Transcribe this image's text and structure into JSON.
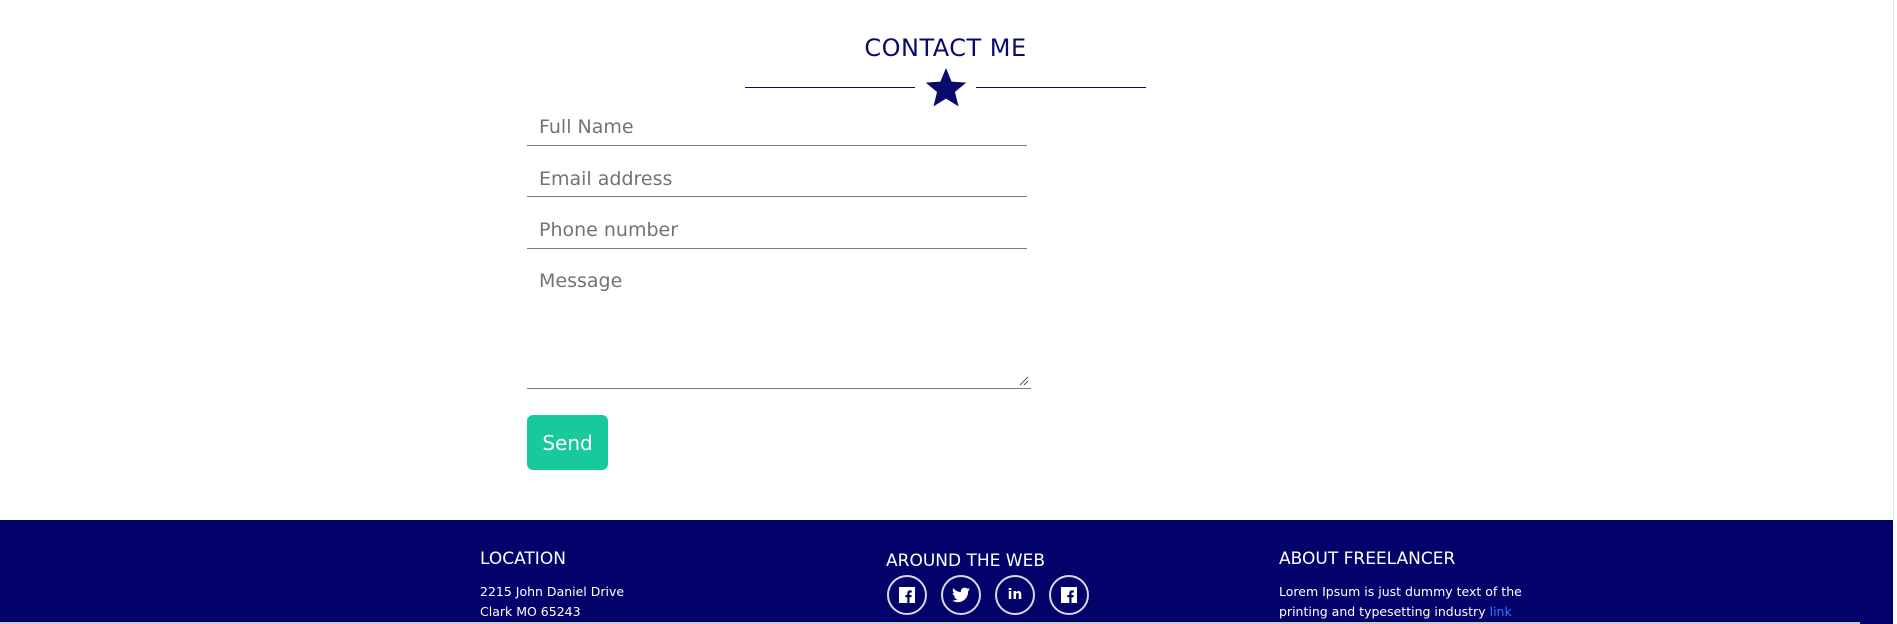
{
  "contact": {
    "title": "CONTACT ME",
    "divider_icon": "star-icon",
    "fields": {
      "full_name_placeholder": "Full Name",
      "email_placeholder": "Email address",
      "phone_placeholder": "Phone number",
      "message_placeholder": "Message"
    },
    "send_label": "Send"
  },
  "footer": {
    "location": {
      "title": "LOCATION",
      "line1": "2215 John Daniel Drive",
      "line2": "Clark MO 65243"
    },
    "web": {
      "title": "AROUND THE WEB",
      "icons": [
        "facebook-icon",
        "twitter-icon",
        "linkedin-icon",
        "facebook-icon"
      ],
      "linkedin_text": "in"
    },
    "about": {
      "title": "ABOUT FREELANCER",
      "line1": "Lorem Ipsum is just dummy text of the",
      "line2": "printing and typesetting industry",
      "link_text": "link"
    }
  },
  "colors": {
    "primary_navy": "#02026a",
    "heading_navy": "#0a0a6b",
    "accent_green": "#18c99c",
    "link_blue": "#2a7bff"
  }
}
